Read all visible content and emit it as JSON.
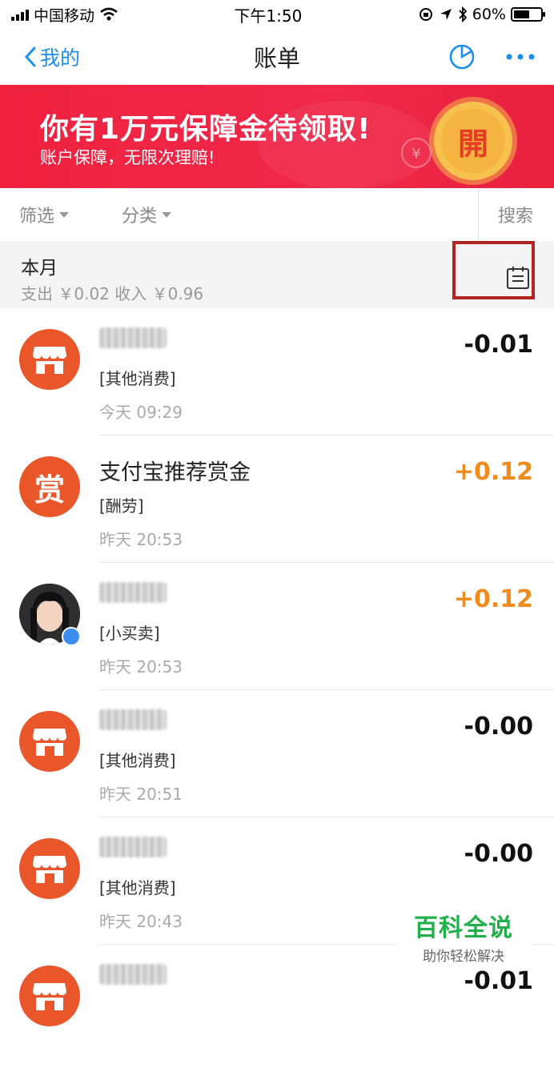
{
  "status_bar": {
    "carrier": "中国移动",
    "time": "下午1:50",
    "battery_percent": "60%",
    "battery_level": 0.6
  },
  "nav": {
    "back_label": "我的",
    "title": "账单",
    "icons": [
      "chevron-left-icon",
      "pie-chart-icon",
      "more-icon"
    ],
    "accent": "#1c8ef0"
  },
  "banner": {
    "headline": "你有1万元保障金待领取!",
    "subline": "账户保障，无限次理赔!",
    "coin_text": "開",
    "colors": {
      "background": "#f0213f",
      "coin": "#f6c14d"
    }
  },
  "filters": {
    "filter_label": "筛选",
    "category_label": "分类",
    "search_label": "搜索"
  },
  "month_summary": {
    "title": "本月",
    "summary": "支出 ￥0.02    收入 ￥0.96",
    "calendar_icon": "calendar-icon"
  },
  "transactions": [
    {
      "name": "",
      "category": "[其他消费]",
      "time": "今天  09:29",
      "amount": "-0.01",
      "icon": "store-icon"
    },
    {
      "name": "支付宝推荐赏金",
      "category": "[酬劳]",
      "time": "昨天  20:53",
      "amount": "+0.12",
      "icon": "reward-icon",
      "icon_text": "赏"
    },
    {
      "name": "",
      "category": "[小买卖]",
      "time": "昨天  20:53",
      "amount": "+0.12",
      "icon": "user-avatar"
    },
    {
      "name": "",
      "category": "[其他消费]",
      "time": "昨天  20:51",
      "amount": "-0.00",
      "icon": "store-icon"
    },
    {
      "name": "",
      "category": "[其他消费]",
      "time": "昨天  20:43",
      "amount": "-0.00",
      "icon": "store-icon"
    },
    {
      "name": "",
      "category": "",
      "time": "",
      "amount": "-0.01",
      "icon": "store-icon"
    }
  ],
  "watermark": {
    "title": "百科全说",
    "subtitle": "助你轻松解决"
  }
}
